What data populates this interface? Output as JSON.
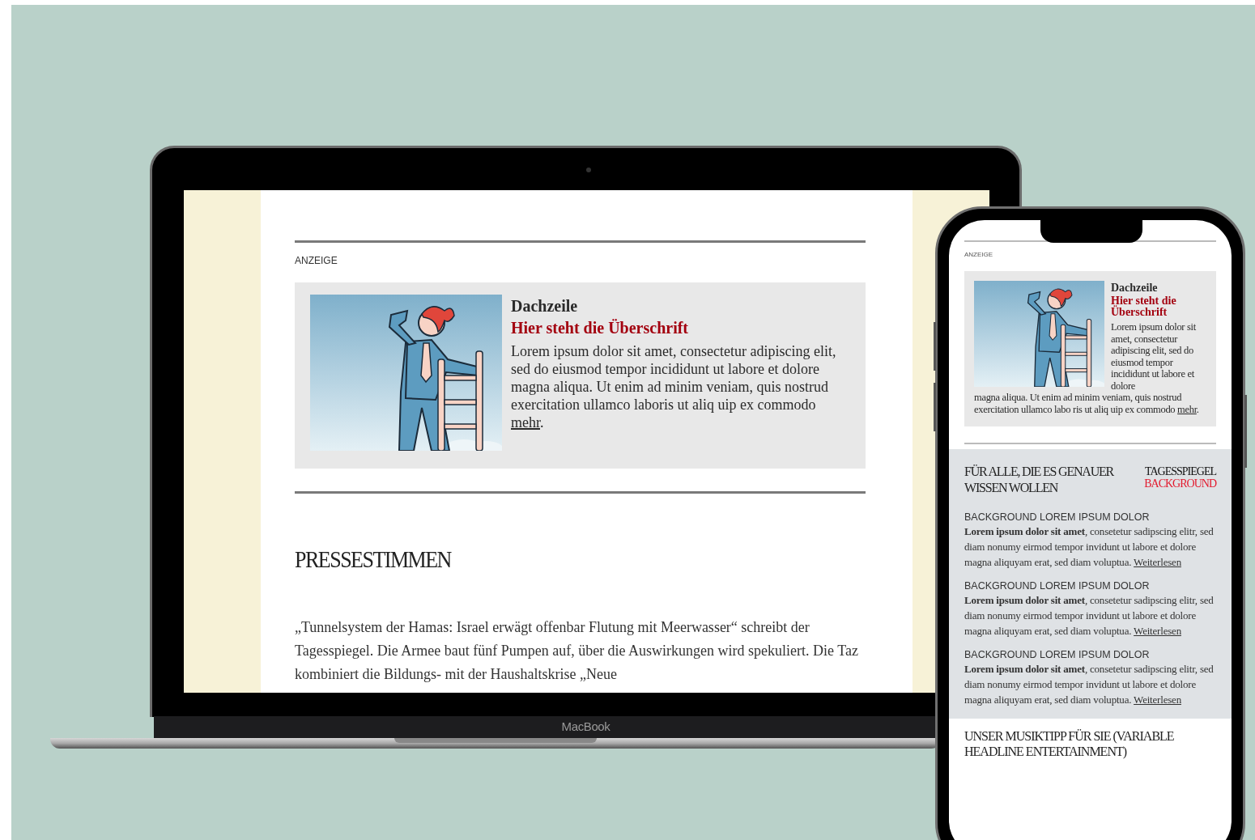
{
  "laptop": {
    "brand": "MacBook",
    "screen": {
      "ad_label": "ANZEIGE",
      "ad": {
        "kicker": "Dachzeile",
        "headline": "Hier steht die Überschrift",
        "body": "Lorem ipsum dolor sit amet, consectetur adipiscing elit, sed do eiusmod tempor incididunt ut labore et dolore magna aliqua. Ut enim ad minim veniam, quis nostrud exercitation ullamco laboris ut aliq uip ex commodo",
        "link": "mehr",
        "link_suffix": "."
      },
      "section_title": "PRESSESTIMMEN",
      "press_text": "„Tunnelsystem der Hamas: Israel erwägt offenbar Flutung mit Meerwasser“ schreibt der Tagesspiegel. Die Armee baut fünf Pumpen auf, über die Auswirkungen wird spekuliert. Die Taz kombiniert die Bildungs- mit der Haushaltskrise „Neue"
    }
  },
  "phone": {
    "ad_label": "ANZEIGE",
    "ad": {
      "kicker": "Dachzeile",
      "headline": "Hier steht die Überschrift",
      "body_beside": "Lorem ipsum dolor sit amet, consectetur adipiscing elit, sed do eiusmod tempor incididunt ut labore et dolore",
      "body_below": "magna aliqua. Ut enim ad minim veniam, quis nostrud exercitation ullamco labo ris ut aliq uip ex commodo",
      "link": "mehr",
      "link_suffix": "."
    },
    "background_teaser": {
      "title": "FÜR ALLE, DIE ES GENAUER WISSEN WOLLEN",
      "logo_top": "TAGESSPIEGEL",
      "logo_bottom": "BACKGROUND",
      "items": [
        {
          "label": "BACKGROUND LOREM IPSUM DOLOR",
          "text": "**Lorem ipsum dolor sit amet**, consetetur sadipscing elitr, sed diam nonumy eirmod tempor invidunt ut labore et dolore magna aliquyam erat, sed diam voluptua.",
          "link": "Weiterlesen"
        },
        {
          "label": "BACKGROUND LOREM IPSUM DOLOR",
          "text": "**Lorem ipsum dolor sit amet**, consetetur sadipscing elitr, sed diam nonumy eirmod tempor invidunt ut labore et dolore magna aliquyam erat, sed diam voluptua.",
          "link": "Weiterlesen"
        },
        {
          "label": "BACKGROUND LOREM IPSUM DOLOR",
          "text": "**Lorem ipsum dolor sit amet**, consetetur sadipscing elitr, sed diam nonumy eirmod tempor invidunt ut labore et dolore magna aliquyam erat, sed diam voluptua.",
          "link": "Weiterlesen"
        }
      ]
    },
    "music_title": "UNSER MUSIKTIPP FÜR SIE (VARIABLE HEADLINE ENTERTAINMENT)"
  }
}
